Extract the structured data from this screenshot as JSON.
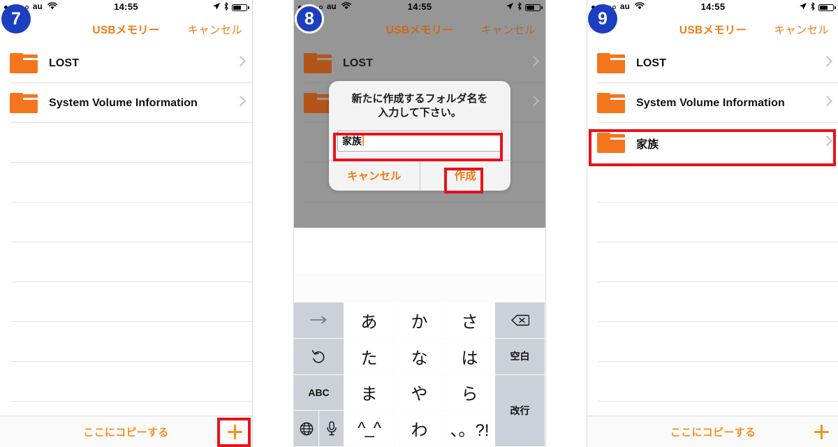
{
  "status_bar": {
    "carrier": "au",
    "time": "14:55",
    "signal_dots": 5,
    "signal_filled": 3,
    "battery_percent": 55,
    "icons": [
      "signal-dots-icon",
      "wifi-icon",
      "location-arrow-icon",
      "bluetooth-icon",
      "battery-icon"
    ]
  },
  "nav": {
    "title": "USBメモリー",
    "cancel_label": "キャンセル"
  },
  "toolbar": {
    "copy_label": "ここにコピーする",
    "add_label": "+"
  },
  "badges": {
    "panel1": "7",
    "panel2": "8",
    "panel3": "9",
    "color": "#1c3fbf"
  },
  "colors": {
    "accent_orange": "#f07c13",
    "folder_orange": "#f4761c",
    "plus_orange": "#f7901e",
    "highlight_red": "#e8121a",
    "dim_gray": "#969696",
    "badge_blue": "#1c3fbf",
    "keyboard_gray": "#ccd1d9"
  },
  "panel1": {
    "rows": [
      {
        "label": "LOST",
        "has_folder": true
      },
      {
        "label": "System Volume Information",
        "has_folder": true
      }
    ],
    "empty_rows": 7,
    "highlight": "add-folder-button"
  },
  "panel2": {
    "rows": [
      {
        "label": "LOST",
        "has_folder": true
      },
      {
        "label": "System Volume Information",
        "has_folder": true
      }
    ],
    "empty_rows": 2,
    "dialog": {
      "message_line1": "新たに作成するフォルダ名を",
      "message_line2": "入力して下さい。",
      "input_value": "家族",
      "input_placeholder": "",
      "cancel_label": "キャンセル",
      "confirm_label": "作成"
    },
    "highlights": [
      "text-input-field",
      "create-button"
    ]
  },
  "panel3": {
    "rows": [
      {
        "label": "LOST",
        "has_folder": true
      },
      {
        "label": "System Volume Information",
        "has_folder": true
      },
      {
        "label": "家族",
        "has_folder": true
      }
    ],
    "empty_rows": 6,
    "highlight": "new-folder-row"
  },
  "keyboard": {
    "rows": [
      [
        {
          "key": "next-candidate-key",
          "label": "→",
          "type": "func"
        },
        {
          "key": "a-row-key",
          "label": "あ",
          "type": "char"
        },
        {
          "key": "ka-row-key",
          "label": "か",
          "type": "char"
        },
        {
          "key": "sa-row-key",
          "label": "さ",
          "type": "char"
        },
        {
          "key": "delete-key",
          "label": "⌫",
          "type": "func"
        }
      ],
      [
        {
          "key": "undo-key",
          "label": "↺",
          "type": "func"
        },
        {
          "key": "ta-row-key",
          "label": "た",
          "type": "char"
        },
        {
          "key": "na-row-key",
          "label": "な",
          "type": "char"
        },
        {
          "key": "ha-row-key",
          "label": "は",
          "type": "char"
        },
        {
          "key": "space-key",
          "label": "空白",
          "type": "func"
        }
      ],
      [
        {
          "key": "abc-key",
          "label": "ABC",
          "type": "func"
        },
        {
          "key": "ma-row-key",
          "label": "ま",
          "type": "char"
        },
        {
          "key": "ya-row-key",
          "label": "や",
          "type": "char"
        },
        {
          "key": "ra-row-key",
          "label": "ら",
          "type": "char"
        },
        {
          "key": "return-key",
          "label": "改行",
          "type": "func"
        }
      ],
      [
        {
          "key": "globe-key",
          "label": "🌐",
          "type": "func"
        },
        {
          "key": "emoji-key",
          "label": "^_^",
          "type": "char"
        },
        {
          "key": "wa-row-key",
          "label": "わ",
          "type": "char"
        },
        {
          "key": "punctuation-key",
          "label": "、。?!",
          "type": "char"
        }
      ]
    ],
    "dictation_key": "マイク",
    "space_label": "空白",
    "return_label": "改行",
    "abc_label": "ABC"
  }
}
